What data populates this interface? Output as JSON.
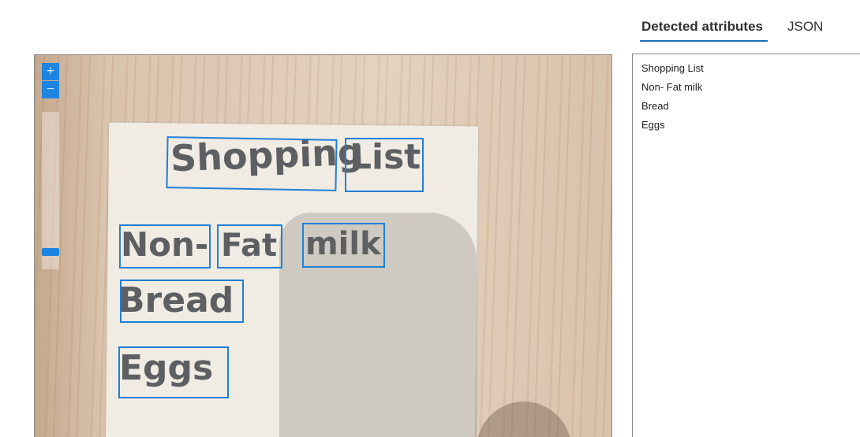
{
  "tabs": [
    {
      "label": "Detected attributes",
      "active": true
    },
    {
      "label": "JSON",
      "active": false
    }
  ],
  "zoom": {
    "in_label": "+",
    "out_label": "−"
  },
  "attributes": [
    "Shopping List",
    "Non- Fat milk",
    "Bread",
    "Eggs"
  ],
  "note_words": [
    "Shopping",
    "List",
    "Non-",
    "Fat",
    "milk",
    "Bread",
    "Eggs"
  ],
  "colors": {
    "accent": "#1d84e0",
    "detection_box": "#1f7fd8",
    "tab_underline": "#1f6fb5",
    "border": "#8a8886"
  }
}
